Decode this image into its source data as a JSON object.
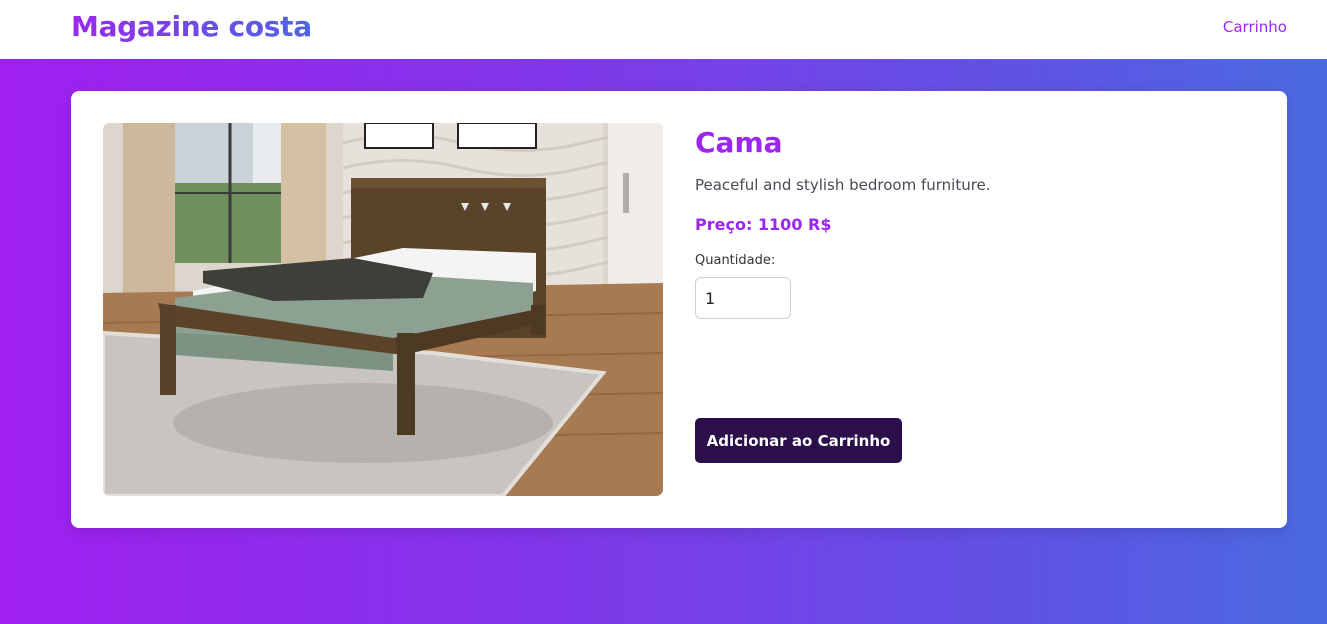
{
  "header": {
    "brand": "Magazine costa",
    "cart_link": "Carrinho"
  },
  "product": {
    "image_alt": "Cama",
    "title": "Cama",
    "description": "Peaceful and stylish bedroom furniture.",
    "price_text": "Preço: 1100 R$",
    "quantity_label": "Quantidade:",
    "quantity_value": "1",
    "add_button_label": "Adicionar ao Carrinho"
  },
  "colors": {
    "accent": "#9b27ee",
    "button": "#2a0f4a",
    "gradient_start": "#a020f0",
    "gradient_end": "#4a6ae0"
  }
}
